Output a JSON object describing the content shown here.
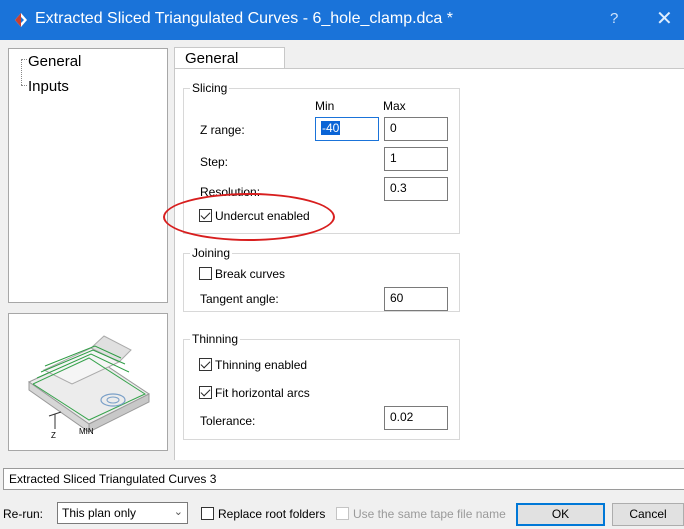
{
  "window": {
    "title": "Extracted Sliced Triangulated Curves - 6_hole_clamp.dca *",
    "help_glyph": "?",
    "close_glyph": "✕",
    "accent_color": "#1a73d9"
  },
  "tree": {
    "items": [
      {
        "label": "General"
      },
      {
        "label": "Inputs"
      }
    ]
  },
  "preview": {
    "axis_label": "Z",
    "min_label": "MIN"
  },
  "tab": {
    "label": "General"
  },
  "slicing": {
    "legend": "Slicing",
    "col_min": "Min",
    "col_max": "Max",
    "z_range_label": "Z range:",
    "z_min": "-40",
    "z_max": "0",
    "step_label": "Step:",
    "step_value": "1",
    "resolution_label": "Resolution:",
    "resolution_value": "0.3",
    "undercut_label": "Undercut enabled",
    "undercut_checked": true
  },
  "joining": {
    "legend": "Joining",
    "break_curves_label": "Break curves",
    "break_curves_checked": false,
    "tangent_label": "Tangent angle:",
    "tangent_value": "60"
  },
  "thinning": {
    "legend": "Thinning",
    "enabled_label": "Thinning enabled",
    "enabled_checked": true,
    "fit_arcs_label": "Fit horizontal arcs",
    "fit_arcs_checked": true,
    "tolerance_label": "Tolerance:",
    "tolerance_value": "0.02"
  },
  "status": {
    "text": "Extracted Sliced Triangulated Curves 3"
  },
  "footer": {
    "rerun_label": "Re-run:",
    "rerun_value": "This plan only",
    "replace_root_label": "Replace root folders",
    "same_tape_label": "Use the same tape file name",
    "ok_label": "OK",
    "cancel_label": "Cancel"
  }
}
